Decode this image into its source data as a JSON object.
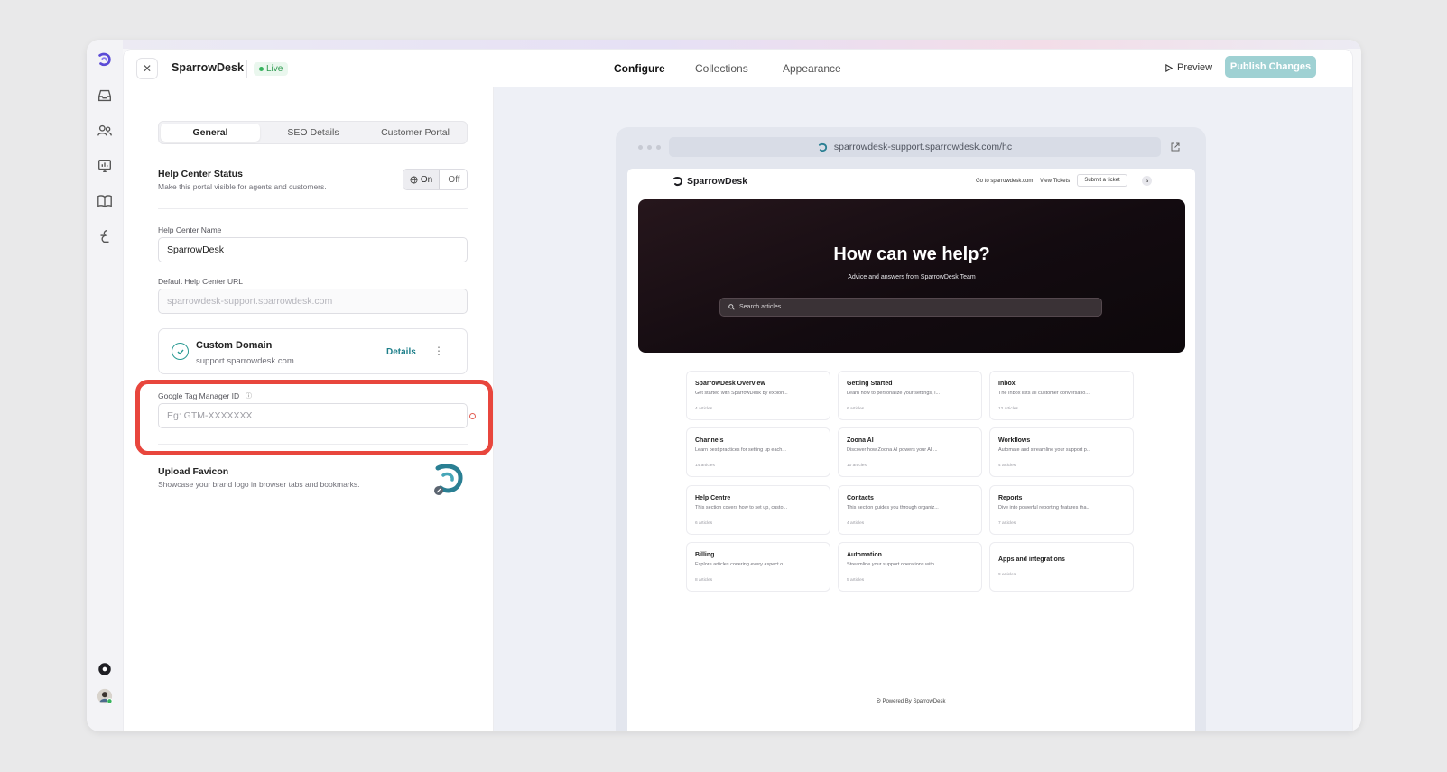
{
  "header": {
    "brand": "SparrowDesk",
    "status_badge": "Live",
    "tabs": [
      "Configure",
      "Collections",
      "Appearance"
    ],
    "preview_label": "Preview",
    "publish_label": "Publish Changes"
  },
  "settings": {
    "segments": [
      "General",
      "SEO Details",
      "Customer Portal"
    ],
    "help_center_status": {
      "title": "Help Center Status",
      "description": "Make this portal visible for agents and customers.",
      "on_label": "On",
      "off_label": "Off"
    },
    "help_center_name": {
      "label": "Help Center Name",
      "value": "SparrowDesk"
    },
    "default_url": {
      "label": "Default Help Center URL",
      "value": "sparrowdesk-support.sparrowdesk.com"
    },
    "custom_domain": {
      "title": "Custom Domain",
      "domain": "support.sparrowdesk.com",
      "details_label": "Details"
    },
    "gtm": {
      "label": "Google Tag Manager ID",
      "placeholder": "Eg: GTM-XXXXXXX"
    },
    "favicon": {
      "title": "Upload Favicon",
      "description": "Showcase your brand logo in browser tabs and bookmarks."
    }
  },
  "preview": {
    "url": "sparrowdesk-support.sparrowdesk.com/hc",
    "site": {
      "logo_text": "SparrowDesk",
      "nav": [
        "Go to sparrowdesk.com",
        "View Tickets"
      ],
      "submit_ticket": "Submit a ticket",
      "avatar_letter": "S",
      "hero_title": "How can we help?",
      "hero_subtitle": "Advice and answers from SparrowDesk Team",
      "search_placeholder": "Search articles",
      "cards": [
        {
          "title": "SparrowDesk Overview",
          "desc": "Get started with SparrowDesk by explori...",
          "count": "4 articles"
        },
        {
          "title": "Getting Started",
          "desc": "Learn how to personalize your settings, i...",
          "count": "6 articles"
        },
        {
          "title": "Inbox",
          "desc": "The Inbox lists all customer conversatio...",
          "count": "12 articles"
        },
        {
          "title": "Channels",
          "desc": "Learn best practices for setting up each...",
          "count": "14 articles"
        },
        {
          "title": "Zoona AI",
          "desc": "Discover how Zoona AI powers your AI ...",
          "count": "10 articles"
        },
        {
          "title": "Workflows",
          "desc": "Automate and streamline your support p...",
          "count": "4 articles"
        },
        {
          "title": "Help Centre",
          "desc": "This section covers how to set up, custo...",
          "count": "6 articles"
        },
        {
          "title": "Contacts",
          "desc": "This section guides you through organiz...",
          "count": "4 articles"
        },
        {
          "title": "Reports",
          "desc": "Dive into powerful reporting features tha...",
          "count": "7 articles"
        },
        {
          "title": "Billing",
          "desc": "Explore articles covering every aspect o...",
          "count": "8 articles"
        },
        {
          "title": "Automation",
          "desc": "Streamline your support operations with...",
          "count": "5 articles"
        },
        {
          "title": "Apps and integrations",
          "desc": "",
          "count": "9 articles"
        }
      ],
      "powered_by": "Powered By SparrowDesk"
    }
  },
  "colors": {
    "accent_teal": "#1e7f8a",
    "publish_disabled": "#9fd1d3",
    "live_green": "#37b35d",
    "highlight_red": "#e8463d"
  }
}
